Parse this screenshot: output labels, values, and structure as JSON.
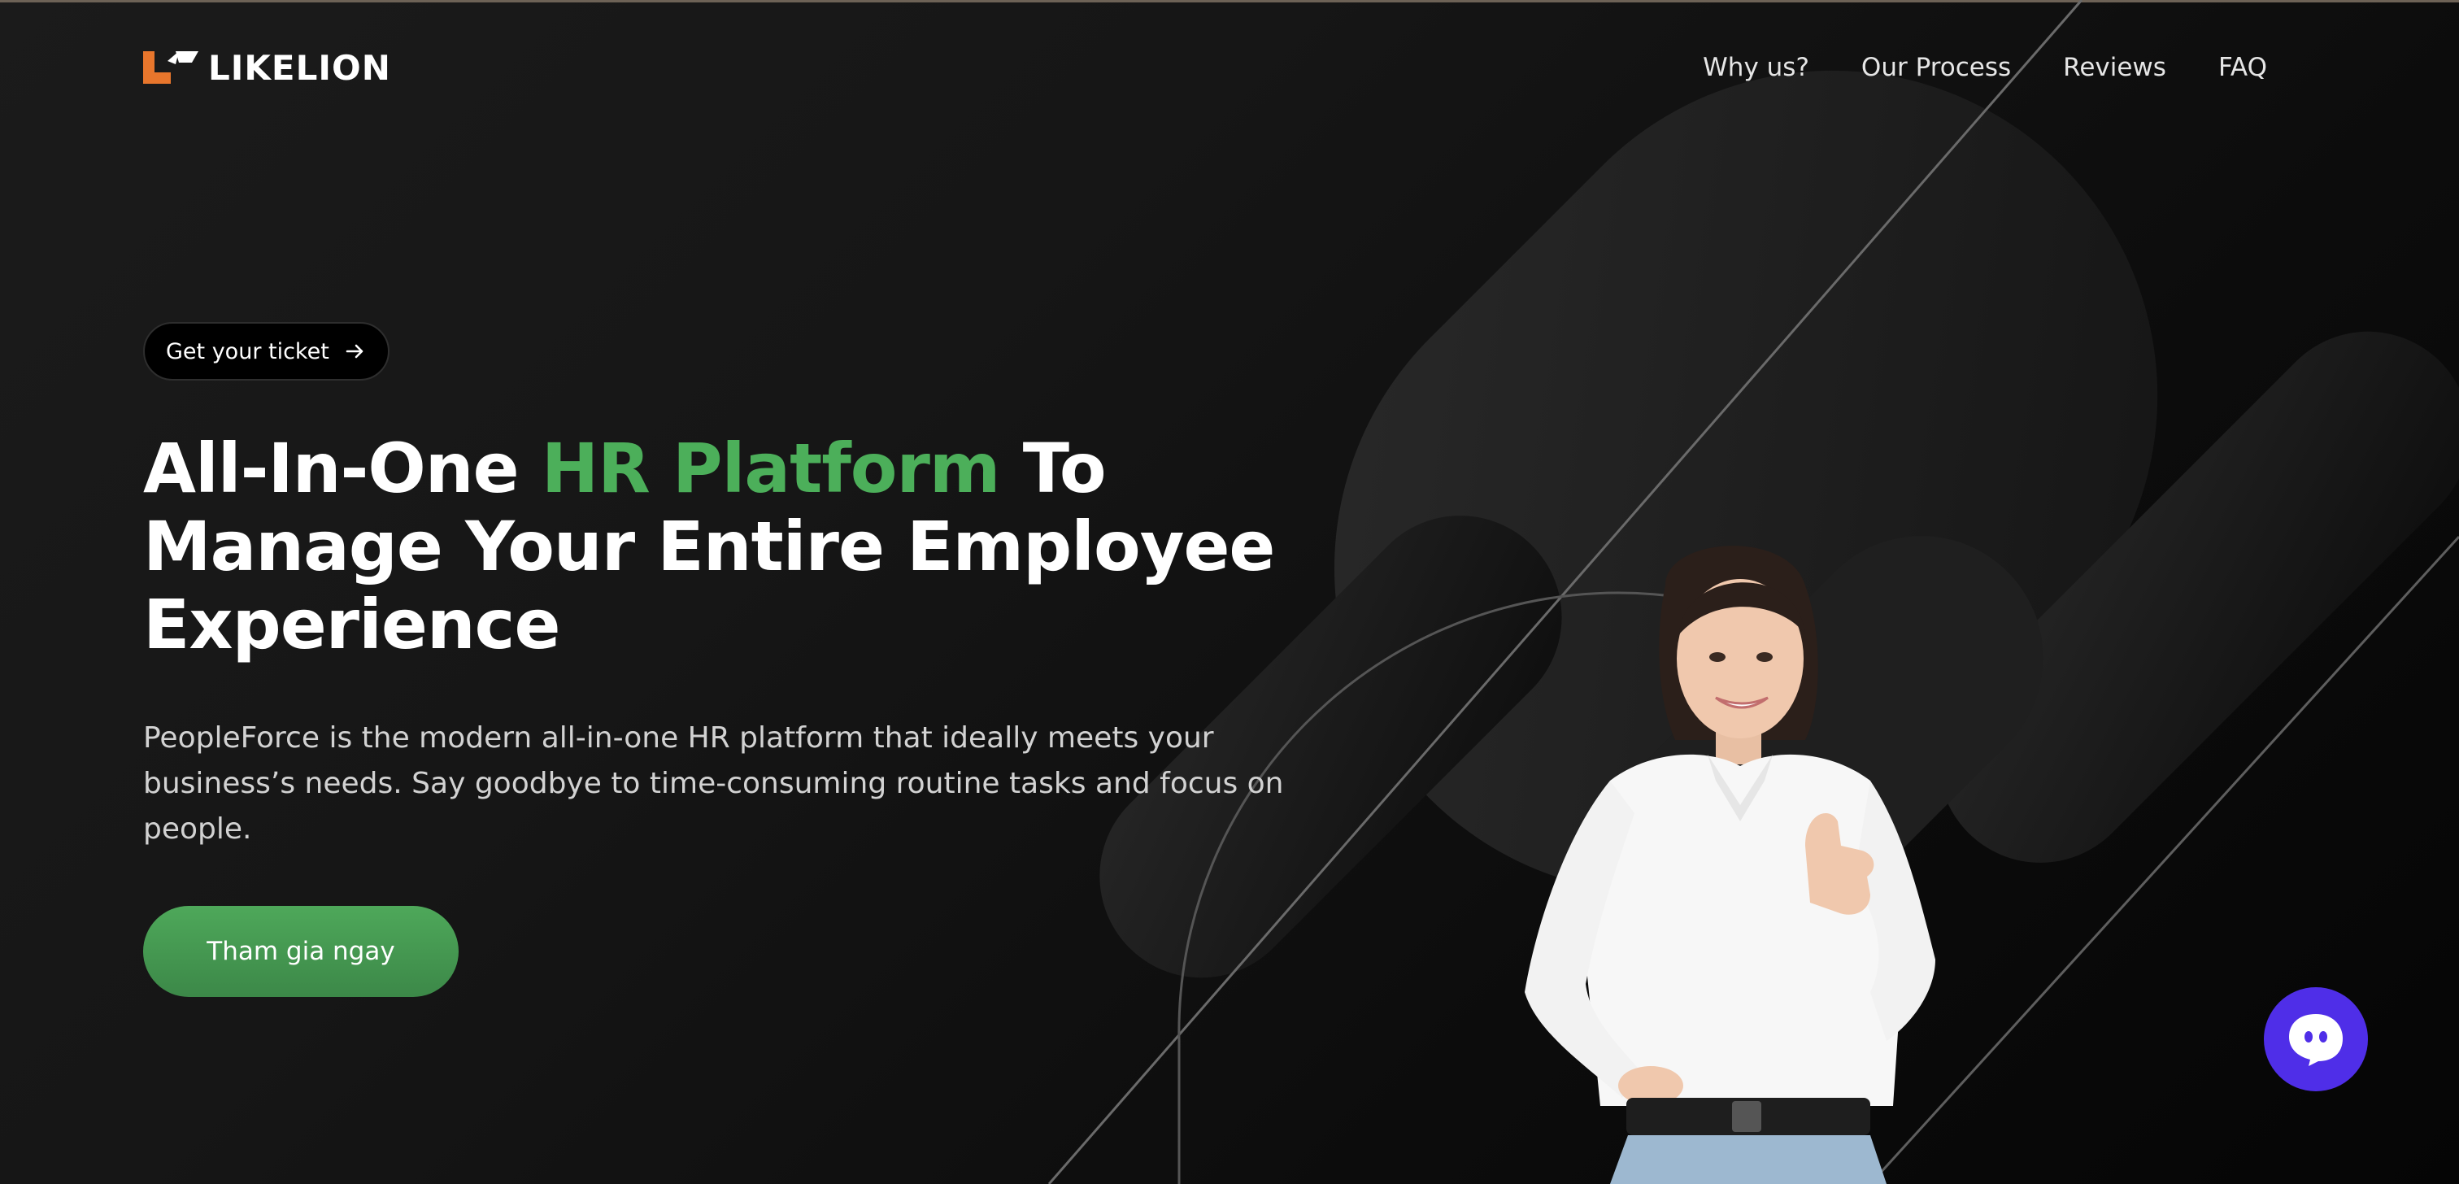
{
  "brand": {
    "name": "LIKELION",
    "accent_color": "#e8762c"
  },
  "nav": {
    "items": [
      {
        "label": "Why us?"
      },
      {
        "label": "Our Process"
      },
      {
        "label": "Reviews"
      },
      {
        "label": "FAQ"
      }
    ]
  },
  "hero": {
    "ticket_label": "Get your ticket",
    "headline_part1": "All-In-One ",
    "headline_accent": "HR Platform",
    "headline_part2": " To Manage Your Entire Employee Experience",
    "description": "PeopleForce is the modern all-in-one HR platform that ideally meets your business’s needs. Say goodbye to time-consuming routine tasks and focus on people.",
    "cta_label": "Tham gia ngay",
    "accent_color": "#4caf5a"
  },
  "chat": {
    "icon": "chat-bubble-icon",
    "color": "#4f2ee8"
  },
  "icons": {
    "ticket_arrow": "arrow-right-icon",
    "logo_mark": "likelion-logo-icon"
  }
}
